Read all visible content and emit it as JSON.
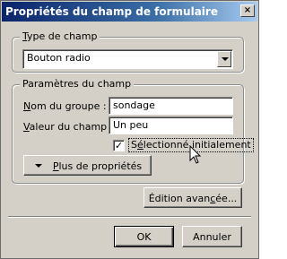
{
  "window": {
    "title": "Propriétés du champ de formulaire",
    "close_glyph": "×"
  },
  "type_group": {
    "legend_accel": "T",
    "legend_rest": "ype de champ",
    "selected": "Bouton radio"
  },
  "params_group": {
    "legend": "Paramètres du champ",
    "group_name_accel": "N",
    "group_name_rest": "om du groupe :",
    "group_name_value": "sondage",
    "value_accel": "V",
    "value_rest": "aleur du champ :",
    "value_value": "Un peu",
    "checkbox_label_before": "S",
    "checkbox_label_accel": "é",
    "checkbox_label_after": "lectionné initialement",
    "checkbox_checked": true,
    "checkbox_mark": "✓",
    "more_accel": "P",
    "more_rest": "lus de propriétés"
  },
  "buttons": {
    "advanced_before": "Édition avan",
    "advanced_accel": "c",
    "advanced_after": "ée...",
    "ok": "OK",
    "cancel": "Annuler"
  }
}
